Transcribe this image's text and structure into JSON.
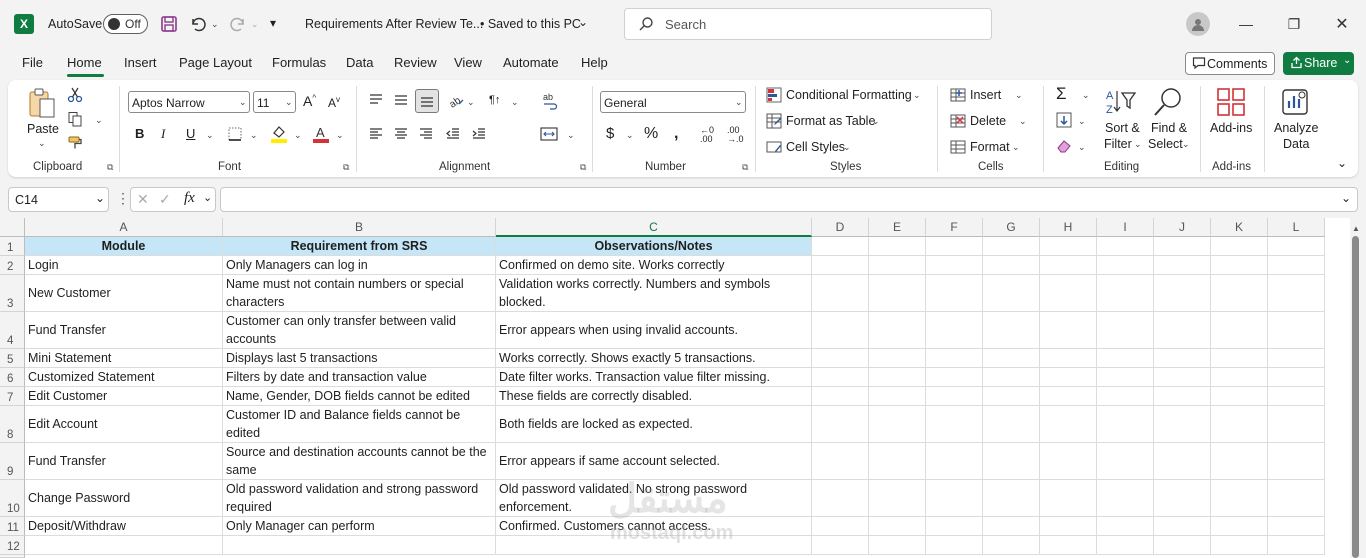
{
  "titlebar": {
    "autosave_label": "AutoSave",
    "autosave_state": "Off",
    "doc_title": "Requirements After Review Te...",
    "save_status": "• Saved to this PC",
    "search_placeholder": "Search"
  },
  "menu": [
    "File",
    "Home",
    "Insert",
    "Page Layout",
    "Formulas",
    "Data",
    "Review",
    "View",
    "Automate",
    "Help"
  ],
  "comments_label": "Comments",
  "share_label": "Share",
  "ribbon": {
    "paste": "Paste",
    "font_name": "Aptos Narrow",
    "font_size": "11",
    "number_format": "General",
    "conditional_formatting": "Conditional Formatting",
    "format_as_table": "Format as Table",
    "cell_styles": "Cell Styles",
    "insert": "Insert",
    "delete": "Delete",
    "format": "Format",
    "sort_filter_1": "Sort &",
    "sort_filter_2": "Filter",
    "find_select_1": "Find &",
    "find_select_2": "Select",
    "addins": "Add-ins",
    "analyze_1": "Analyze",
    "analyze_2": "Data",
    "groups": {
      "clipboard": "Clipboard",
      "font": "Font",
      "alignment": "Alignment",
      "number": "Number",
      "styles": "Styles",
      "cells": "Cells",
      "editing": "Editing",
      "addins": "Add-ins"
    }
  },
  "namebox": "C14",
  "fx": "fx",
  "columns": [
    "A",
    "B",
    "C",
    "D",
    "E",
    "F",
    "G",
    "H",
    "I",
    "J",
    "K",
    "L"
  ],
  "row_numbers": [
    "1",
    "2",
    "3",
    "4",
    "5",
    "6",
    "7",
    "8",
    "9",
    "10",
    "11",
    "12"
  ],
  "rows": [
    [
      "Module",
      "Requirement from SRS",
      "Observations/Notes"
    ],
    [
      "Login",
      "Only Managers can log in",
      "Confirmed on demo site. Works correctly"
    ],
    [
      "New Customer",
      "Name must not contain numbers or special characters",
      "Validation works correctly. Numbers and symbols blocked."
    ],
    [
      "Fund Transfer",
      "Customer can only transfer between valid accounts",
      "Error appears when using invalid accounts."
    ],
    [
      "Mini Statement",
      "Displays last 5 transactions",
      "Works correctly. Shows exactly 5 transactions."
    ],
    [
      "Customized Statement",
      "Filters by date and transaction value",
      "Date filter works. Transaction value filter missing."
    ],
    [
      "Edit Customer",
      "Name, Gender, DOB fields cannot be edited",
      "These fields are correctly disabled."
    ],
    [
      "Edit Account",
      "Customer ID and Balance fields cannot be edited",
      "Both fields are locked as expected."
    ],
    [
      "Fund Transfer",
      "Source and destination accounts cannot be the same",
      "Error appears if same account selected."
    ],
    [
      "Change Password",
      "Old password validation and strong password required",
      "Old password validated. No strong password enforcement."
    ],
    [
      "Deposit/Withdraw",
      "Only Manager can perform",
      "Confirmed. Customers cannot access."
    ],
    [
      "",
      "",
      ""
    ]
  ],
  "watermark": {
    "line1": "مستقل",
    "line2": "mostaql.com"
  }
}
